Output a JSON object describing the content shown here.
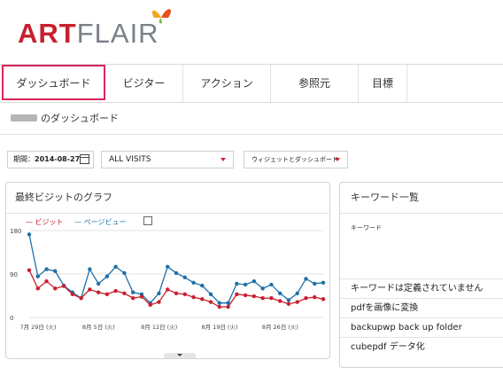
{
  "logo": {
    "text_art": "ART",
    "text_flair": "FLAIR"
  },
  "tabs": [
    {
      "label": "ダッシュボード"
    },
    {
      "label": "ビジター"
    },
    {
      "label": "アクション"
    },
    {
      "label": "参照元"
    },
    {
      "label": "目標"
    }
  ],
  "subheader": {
    "title": "のダッシュボード"
  },
  "filters": {
    "period_label": "期間：",
    "period_value": "2014-08-27",
    "segment": "ALL VISITS",
    "widget_menu": "ウィジェットとダッシュボード"
  },
  "visits_panel": {
    "title": "最終ビジットのグラフ",
    "legend_visits": "ビジット",
    "legend_pageviews": "ページビュー"
  },
  "keyword_panel": {
    "title": "キーワード一覧",
    "column_header": "キーワード",
    "rows": [
      "キーワードは定義されていません",
      "pdfを画像に変換",
      "backupwp back up folder",
      "cubepdf データ化"
    ]
  },
  "colors": {
    "accent": "#d8265a",
    "visits": "#c8202f",
    "pageviews": "#1f6fa8"
  },
  "chart_data": {
    "type": "line",
    "y_ticks": [
      "180",
      "90",
      "0"
    ],
    "ylim": [
      0,
      180
    ],
    "x_ticks": [
      "7月 29日 (火)",
      "8月 5日 (火)",
      "8月 12日 (火)",
      "8月 19日 (火)",
      "8月 26日 (火)"
    ],
    "series": [
      {
        "name": "ビジット",
        "values": [
          98,
          60,
          75,
          60,
          65,
          48,
          40,
          58,
          52,
          48,
          55,
          50,
          40,
          43,
          26,
          32,
          58,
          50,
          48,
          42,
          38,
          32,
          22,
          22,
          48,
          46,
          44,
          40,
          40,
          34,
          28,
          32,
          40,
          42,
          38
        ]
      },
      {
        "name": "ページビュー",
        "values": [
          172,
          85,
          100,
          96,
          66,
          52,
          40,
          100,
          70,
          85,
          105,
          92,
          52,
          48,
          30,
          50,
          105,
          92,
          83,
          72,
          66,
          48,
          30,
          30,
          70,
          68,
          75,
          60,
          68,
          50,
          36,
          50,
          80,
          70,
          72
        ]
      }
    ]
  }
}
